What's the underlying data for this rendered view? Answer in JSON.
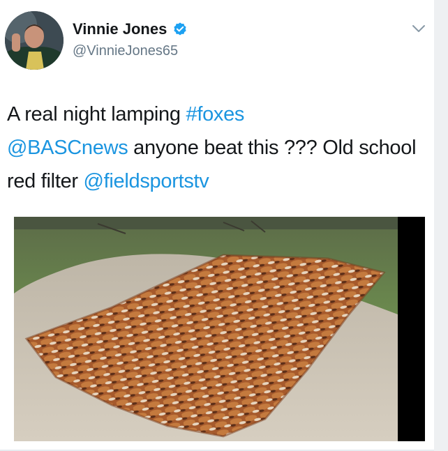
{
  "tweet": {
    "author_name": "Vinnie Jones",
    "handle": "@VinnieJones65",
    "text_parts": {
      "p1": "A real night lamping ",
      "hashtag": "#foxes",
      "mention1": "@BASCnews",
      "p2": " anyone beat this ??? Old school red filter ",
      "mention2": "@fieldsportstv"
    }
  },
  "icons": {
    "verified": "verified-badge-icon",
    "menu": "chevron-down-icon"
  },
  "colors": {
    "link": "#1b95e0",
    "verified": "#1da1f2",
    "handle": "#657786"
  }
}
